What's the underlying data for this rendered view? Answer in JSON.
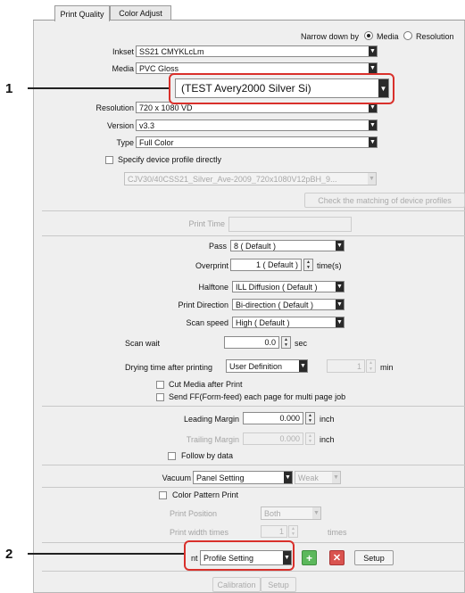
{
  "tabs": [
    {
      "label": "Print Quality"
    },
    {
      "label": "Color Adjust"
    }
  ],
  "narrow_down": {
    "label": "Narrow down by",
    "options": [
      "Media",
      "Resolution"
    ],
    "selected": "Media"
  },
  "inkset": {
    "label": "Inkset",
    "value": "SS21 CMYKLcLm"
  },
  "media": {
    "label": "Media",
    "value": "PVC Gloss"
  },
  "resolution": {
    "label": "Resolution",
    "value": "720 x 1080 VD"
  },
  "version": {
    "label": "Version",
    "value": "v3.3"
  },
  "type": {
    "label": "Type",
    "value": "Full Color"
  },
  "device_profile": {
    "label": "Specify device profile directly",
    "value": "CJV30/40CSS21_Silver_Ave-2009_720x1080V12pBH_9...",
    "check_button": "Check the matching of device profiles"
  },
  "print_time": {
    "label": "Print Time"
  },
  "pass": {
    "label": "Pass",
    "value": "8 ( Default )"
  },
  "overprint": {
    "label": "Overprint",
    "value": "1 ( Default )",
    "unit": "time(s)"
  },
  "halftone": {
    "label": "Halftone",
    "value": "ILL Diffusion ( Default )"
  },
  "print_direction": {
    "label": "Print Direction",
    "value": "Bi-direction ( Default )"
  },
  "scan_speed": {
    "label": "Scan speed",
    "value": "High ( Default )"
  },
  "scan_wait": {
    "label": "Scan wait",
    "value": "0.0",
    "unit": "sec"
  },
  "drying": {
    "label": "Drying time after printing",
    "value": "User Definition",
    "number": "1",
    "unit": "min"
  },
  "cut_media": {
    "label": "Cut Media after Print"
  },
  "send_ff": {
    "label": "Send FF(Form-feed) each page for multi page job"
  },
  "leading_margin": {
    "label": "Leading Margin",
    "value": "0.000",
    "unit": "inch"
  },
  "trailing_margin": {
    "label": "Trailing Margin",
    "value": "0.000",
    "unit": "inch"
  },
  "follow_by_data": {
    "label": "Follow by data"
  },
  "vacuum": {
    "label": "Vacuum",
    "value": "Panel Setting",
    "weak": "Weak"
  },
  "color_pattern": {
    "label": "Color Pattern Print",
    "position_label": "Print Position",
    "position_value": "Both",
    "width_label": "Print width times",
    "width_value": "1",
    "width_unit": "times"
  },
  "print_adjust": {
    "label_tail": "nt",
    "value": "Profile Setting",
    "add_icon": "plus-icon",
    "delete_icon": "x-icon",
    "setup": "Setup"
  },
  "calibration": {
    "label": "Calibration",
    "setup": "Setup"
  },
  "callout1": {
    "number": "1",
    "value": "(TEST Avery2000 Silver Si)"
  },
  "callout2": {
    "number": "2"
  },
  "colors": {
    "callout_border": "#d9302b",
    "add_green": "#5cb85c",
    "delete_red": "#d9534f"
  }
}
